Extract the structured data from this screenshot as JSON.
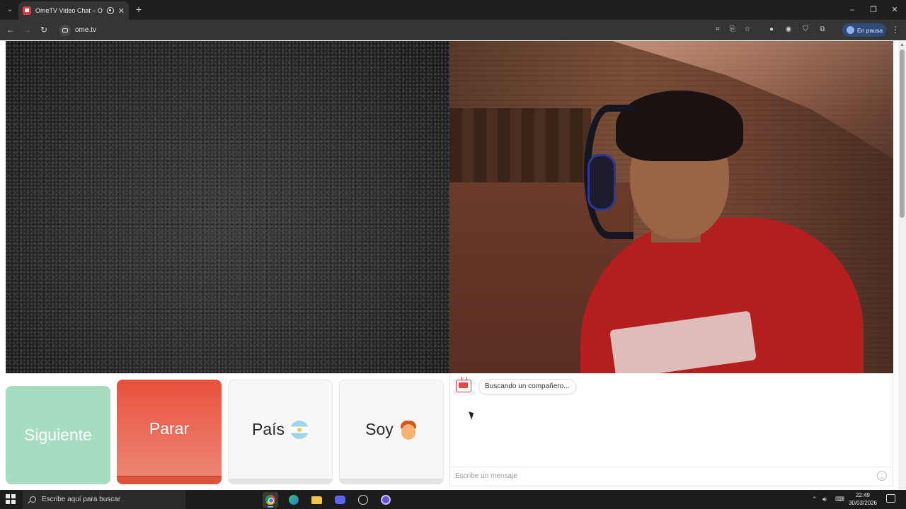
{
  "browser": {
    "tab_title": "OmeTV Video Chat – Ome",
    "tab_close": "✕",
    "new_tab": "+",
    "url": "ome.tv",
    "profile_status": "En pausa",
    "window_controls": [
      "–",
      "❐",
      "✕"
    ]
  },
  "page": {
    "buttons": {
      "next": "Siguiente",
      "stop": "Parar",
      "country": "País",
      "gender": "Soy"
    },
    "country_flag_icon": "argentina-flag-icon",
    "gender_icon": "boy-emoji-icon",
    "chat": {
      "status_message": "Buscando un compañero...",
      "input_placeholder": "Escribe un mensaje"
    }
  },
  "taskbar": {
    "search_placeholder": "Escribe aquí para buscar",
    "time": "22:49",
    "date": "30/03/2026"
  },
  "colors": {
    "next_button": "#a6dcbf",
    "stop_button": "#e8513d",
    "neutral_button": "#f7f7f7",
    "browser_frame": "#1f1f1f",
    "toolbar": "#353535",
    "paused_chip": "#2e4a7a"
  }
}
